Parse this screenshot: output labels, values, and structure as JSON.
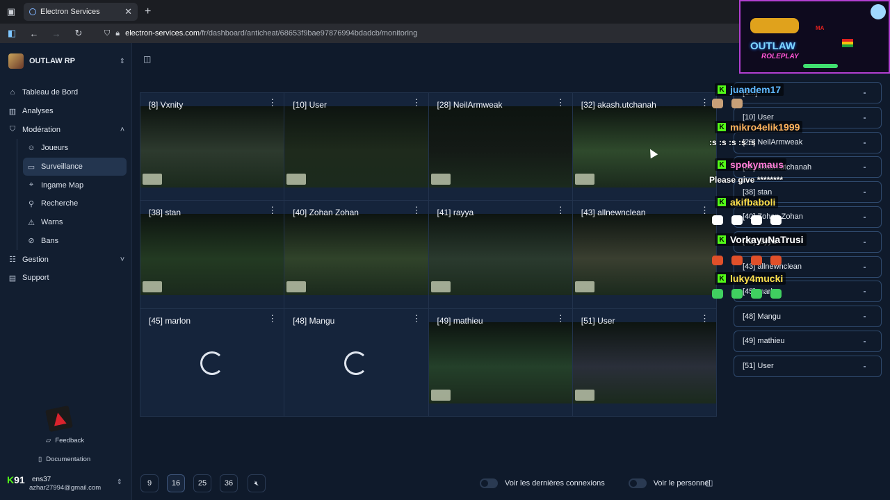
{
  "browser": {
    "tab_title": "Electron Services",
    "url_domain": "electron-services.com",
    "url_path": "/fr/dashboard/anticheat/68653f9bae97876994bdadcb/monitoring"
  },
  "sidebar": {
    "org_name": "OUTLAW RP",
    "nav": {
      "dashboard": "Tableau de Bord",
      "analytics": "Analyses",
      "moderation": "Modération",
      "players": "Joueurs",
      "surveillance": "Surveillance",
      "ingame_map": "Ingame Map",
      "search": "Recherche",
      "warns": "Warns",
      "bans": "Bans",
      "management": "Gestion",
      "support": "Support"
    },
    "feedback": "Feedback",
    "documentation": "Documentation",
    "user_name": "ens37",
    "user_email": "azhar27994@gmail.com"
  },
  "grid": {
    "cells": [
      {
        "label": "[8] Vxnity",
        "state": "video",
        "bg": "#2d3a2e"
      },
      {
        "label": "[10] User",
        "state": "video",
        "bg": "#1e2a1c"
      },
      {
        "label": "[28] NeilArmweak",
        "state": "video",
        "bg": "#141a16"
      },
      {
        "label": "[32] akash.utchanah",
        "state": "video",
        "bg": "#2f4a2c"
      },
      {
        "label": "[38] stan",
        "state": "video",
        "bg": "#233a22"
      },
      {
        "label": "[40] Zohan Zohan",
        "state": "video",
        "bg": "#30432a"
      },
      {
        "label": "[41] rayya",
        "state": "video",
        "bg": "#2a3a2e"
      },
      {
        "label": "[43] allnewnclean",
        "state": "video",
        "bg": "#3a3f30"
      },
      {
        "label": "[45] marlon",
        "state": "loading",
        "bg": ""
      },
      {
        "label": "[48] Mangu",
        "state": "loading",
        "bg": ""
      },
      {
        "label": "[49] mathieu",
        "state": "video",
        "bg": "#24402a"
      },
      {
        "label": "[51] User",
        "state": "video",
        "bg": "#2a2f3a"
      }
    ]
  },
  "pagination": {
    "options": [
      "9",
      "16",
      "25",
      "36"
    ],
    "selected": "16"
  },
  "toggles": {
    "recent_connections": "Voir les dernières connexions",
    "staff": "Voir le personnel"
  },
  "player_list": [
    "[1...]",
    "[10] User",
    "[28] NeilArmweak",
    "[32] akash.utchanah",
    "[38] stan",
    "[40] Zohan Zohan",
    "[41] rayya",
    "[43] allnewnclean",
    "[45] marlon",
    "[48] Mangu",
    "[49] mathieu",
    "[51] User"
  ],
  "stream_overlay": {
    "kick_count": "91",
    "brand_line1": "OUTLAW",
    "brand_line2": "ROLEPLAY",
    "ma_text": "MA",
    "chat": [
      {
        "user": "juandem17",
        "color": "#5eb8ff"
      },
      {
        "user": "mikro4elik1999",
        "color": "#ffb35c"
      },
      {
        "user": "spokymaus",
        "color": "#ff7bd6"
      },
      {
        "user": "akifbaboli",
        "color": "#ffe14d"
      },
      {
        "user": "VorkayuNaTrusi",
        "color": "#ffffff"
      },
      {
        "user": "luky4mucki",
        "color": "#ffe14d"
      }
    ],
    "chat_texts": {
      "spam": ":s :s :s :s :s",
      "request": "Please give ********"
    },
    "accent_colors": {
      "kick": "#53fc18",
      "stream_border": "#b23fd1"
    }
  }
}
